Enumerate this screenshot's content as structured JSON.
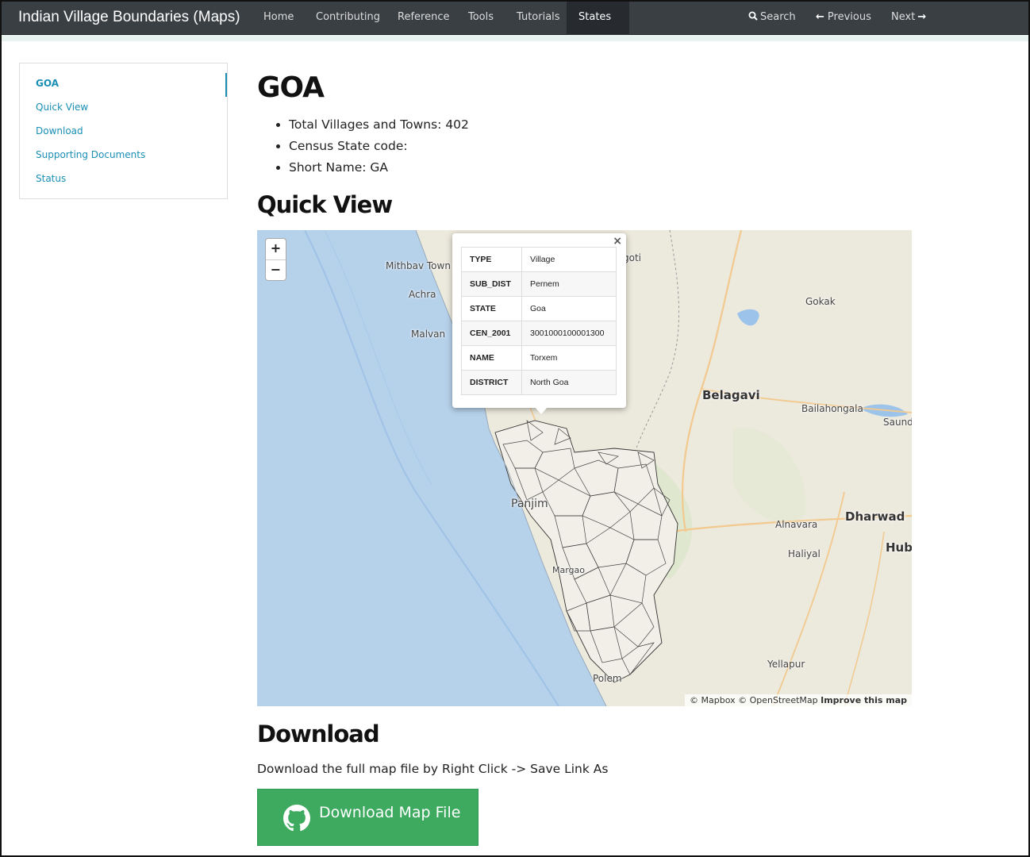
{
  "navbar": {
    "brand": "Indian Village Boundaries (Maps)",
    "items": [
      "Home",
      "Contributing",
      "Reference",
      "Tools",
      "Tutorials",
      "States"
    ],
    "search": "Search",
    "previous": "Previous",
    "next": "Next"
  },
  "sidebar": {
    "items": [
      "GOA",
      "Quick View",
      "Download",
      "Supporting Documents",
      "Status"
    ]
  },
  "main": {
    "title": "GOA",
    "facts": [
      "Total Villages and Towns: 402",
      "Census State code:",
      "Short Name: GA"
    ],
    "quick_view_heading": "Quick View",
    "download_heading": "Download",
    "download_text": "Download the full map file by Right Click -> Save Link As",
    "download_button": "Download Map File"
  },
  "map": {
    "zoom_in": "+",
    "zoom_out": "−",
    "places": [
      "Mithbav Town",
      "Achra",
      "Malvan",
      "Gokak",
      "Belagavi",
      "Bailahongala",
      "Saund",
      "Panjim",
      "Alnavara",
      "Dharwad",
      "Hub",
      "Haliyal",
      "Margao",
      "Yellapur",
      "Polem",
      "goti"
    ],
    "attribution": {
      "mapbox": "© Mapbox",
      "osm": "© OpenStreetMap",
      "improve": "Improve this map"
    },
    "popup": {
      "close": "×",
      "rows": [
        {
          "key": "TYPE",
          "value": "Village"
        },
        {
          "key": "SUB_DIST",
          "value": "Pernem"
        },
        {
          "key": "STATE",
          "value": "Goa"
        },
        {
          "key": "CEN_2001",
          "value": "3001000100001300"
        },
        {
          "key": "NAME",
          "value": "Torxem"
        },
        {
          "key": "DISTRICT",
          "value": "North Goa"
        }
      ]
    }
  },
  "colors": {
    "navbar": "#3a3f44",
    "link": "#1a8fb5",
    "button": "#3daa5f",
    "sea": "#b5d0ec",
    "land": "#ece9dd"
  }
}
